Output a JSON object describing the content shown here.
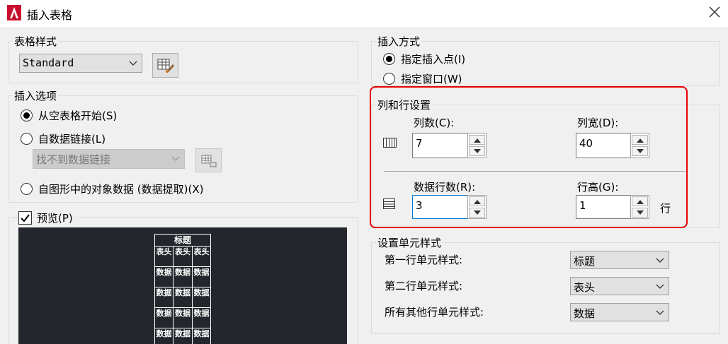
{
  "window": {
    "title": "插入表格"
  },
  "table_style": {
    "legend": "表格样式",
    "selected": "Standard"
  },
  "insert_options": {
    "legend": "插入选项",
    "option_empty": "从空表格开始(S)",
    "option_data_link": "自数据链接(L)",
    "data_link_value": "找不到数据链接",
    "option_drawing_data": "自图形中的对象数据 (数据提取)(X)"
  },
  "preview": {
    "label": "预览(P)",
    "checked": true,
    "title_cell": "标题",
    "header_cells": [
      "表头",
      "表头",
      "表头"
    ],
    "data_cells": [
      "数据",
      "数据",
      "数据"
    ]
  },
  "insert_method": {
    "legend": "插入方式",
    "option_point": "指定插入点(I)",
    "option_window": "指定窗口(W)"
  },
  "col_row": {
    "legend": "列和行设置",
    "columns_label": "列数(C):",
    "columns_value": "7",
    "col_width_label": "列宽(D):",
    "col_width_value": "40",
    "data_rows_label": "数据行数(R):",
    "data_rows_value": "3",
    "row_height_label": "行高(G):",
    "row_height_value": "1",
    "row_unit": "行"
  },
  "cell_styles": {
    "legend": "设置单元样式",
    "first_row_label": "第一行单元样式:",
    "first_row_value": "标题",
    "second_row_label": "第二行单元样式:",
    "second_row_value": "表头",
    "other_rows_label": "所有其他行单元样式:",
    "other_rows_value": "数据"
  },
  "colors": {
    "highlight_border": "#e60000",
    "preview_bg": "#23272d"
  }
}
